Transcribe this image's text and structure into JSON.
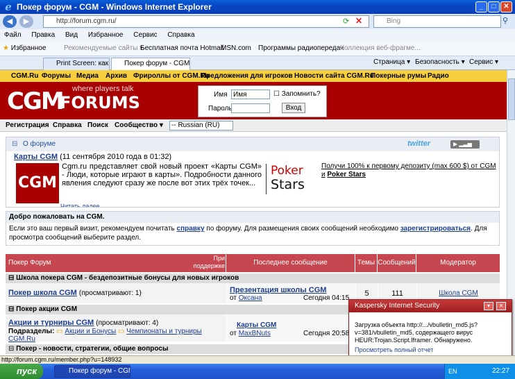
{
  "window": {
    "title": "Покер форум - CGM - Windows Internet Explorer"
  },
  "address": {
    "url": "http://forum.cgm.ru/",
    "search_placeholder": "Bing"
  },
  "menu": [
    "Файл",
    "Правка",
    "Вид",
    "Избранное",
    "Сервис",
    "Справка"
  ],
  "favorites": {
    "label": "Избранное",
    "items": [
      "Рекомендуемые сайты ▾",
      "Бесплатная почта Hotmail",
      "MSN.com",
      "Программы радиопередач",
      "Коллекция веб-фрагме..."
    ],
    "cmd_page": "Страница ▾",
    "cmd_safety": "Безопасность ▾",
    "cmd_service": "Сервис ▾"
  },
  "tabs": [
    "Print Screen: как сделать с...",
    "Покер форум - CGM"
  ],
  "site": {
    "nav": [
      "CGM.Ru",
      "Форумы",
      "Медиа",
      "Архив",
      "Фрироллы от CGM.Ru",
      "Предложения для игроков",
      "Новости сайта CGM.Ru",
      "Покерные румы",
      "Радио"
    ],
    "logo_cgm": "CGM",
    "logo_forums": "FORUMS",
    "logo_tagline": "where players talk",
    "login": {
      "name_label": "Имя",
      "name_value": "Имя",
      "remember": "Запомнить?",
      "pass_label": "Пароль",
      "submit": "Вход"
    },
    "userbar": [
      "Регистрация",
      "Справка",
      "Поиск",
      "Сообщество ▾"
    ],
    "lang_select": "-- Russian (RU)",
    "news": {
      "header": "О форуме",
      "twitter": "twitter",
      "title_link": "Карты CGM",
      "title_date": "(11 сентября 2010 года в 01:32)",
      "body": "Cgm.ru представляет свой новый проект «Карты CGM» - Люди, которые играют в карты». Подробности данного явления следуют сразу же после вот этих трёх точек...",
      "more": "Читать далее",
      "ps_logo_1": "Poker",
      "ps_logo_2": "Stars",
      "ps_text_1": "Получи 100% к первому депозиту (max 600 $) от CGM и",
      "ps_text_2": "Poker Stars"
    },
    "welcome": {
      "header": "Добро пожаловать на CGM.",
      "text_1": "Если это ваш первый визит, рекомендуем почитать ",
      "link_1": "справку",
      "text_2": " по форуму. Для размещения своих сообщений необходимо ",
      "link_2": "зарегистрироваться",
      "text_3": ". Для просмотра сообщений выберите раздел."
    },
    "table": {
      "headers": [
        "Покер Форум",
        "При поддержке",
        "Последнее сообщение",
        "Темы",
        "Сообщений",
        "Модератор"
      ],
      "cat1": "Школа покера CGM - бездепозитные бонусы для новых игроков",
      "row1": {
        "name": "Покер школа CGM",
        "meta": "(просматривают: 1)",
        "last_title": "Презентация школы CGM",
        "last_by": "от",
        "last_user": "Оксана",
        "last_time": "Сегодня 04:15",
        "threads": "5",
        "posts": "111",
        "moderator": "Школа CGM"
      },
      "cat2": "Покер акции CGM",
      "row2": {
        "name": "Акции и турниры CGM",
        "meta": "(просматривают: 4)",
        "sub_label": "Подразделы:",
        "sub_1": "Акции и Бонусы",
        "sub_2": "Чемпионаты и турниры CGM.Ru",
        "last_title": "Карты CGM",
        "last_by": "от",
        "last_user": "MaxBNuts",
        "last_time": "Сегодня 20:58"
      },
      "cat3": "Покер - новости, стратегии, общие вопросы"
    }
  },
  "kaspersky": {
    "title": "Kaspersky Internet Security",
    "message": "Загрузка объекта http://.../vbulletin_md5.js?v=381/vbulletin_md5, содержащего вирус HEUR:Trojan.Script.Iframer. Обнаружено.",
    "link": "Просмотреть полный отчет"
  },
  "status": {
    "text": "http://forum.cgm.ru/member.php?u=148932"
  },
  "taskbar": {
    "start": "пуск",
    "item": "Покер форум - CGM ...",
    "lang": "EN",
    "clock": "22:27"
  },
  "colors": {
    "brand_red": "#a80000",
    "nav_yellow": "#f7cf3e",
    "table_header": "#c6474f"
  }
}
